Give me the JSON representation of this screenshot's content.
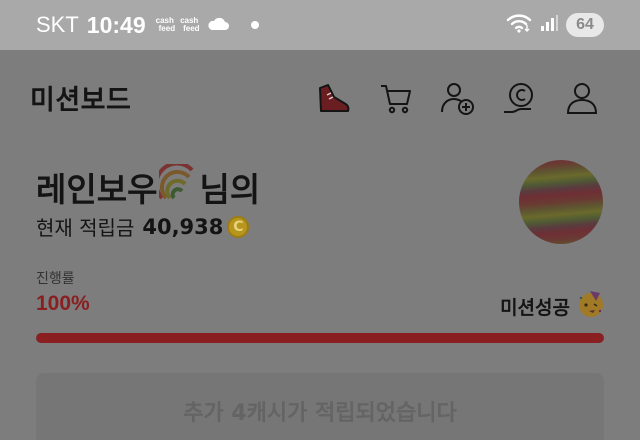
{
  "status_bar": {
    "carrier": "SKT",
    "time": "10:49",
    "notif_icons": [
      {
        "line1": "cash",
        "line2": "feed"
      },
      {
        "line1": "cash",
        "line2": "feed"
      }
    ],
    "battery": "64"
  },
  "header": {
    "title": "미션보드",
    "icons": [
      "shoe-icon",
      "cart-icon",
      "add-friend-icon",
      "coin-hand-icon",
      "profile-icon"
    ]
  },
  "profile": {
    "name_prefix": "레인보우",
    "name_suffix": "님의",
    "balance_label": "현재 적립금",
    "balance_value": "40,938",
    "coin_symbol": "C"
  },
  "progress": {
    "label": "진행률",
    "value_text": "100%",
    "fraction": 1.0,
    "status": "미션성공"
  },
  "notice": {
    "text": "추가 4캐시가 적립되었습니다"
  },
  "colors": {
    "accent": "#8a1f22",
    "status_bar_bg": "#a9a9a9",
    "overlay_bg": "#7d7d7d"
  }
}
